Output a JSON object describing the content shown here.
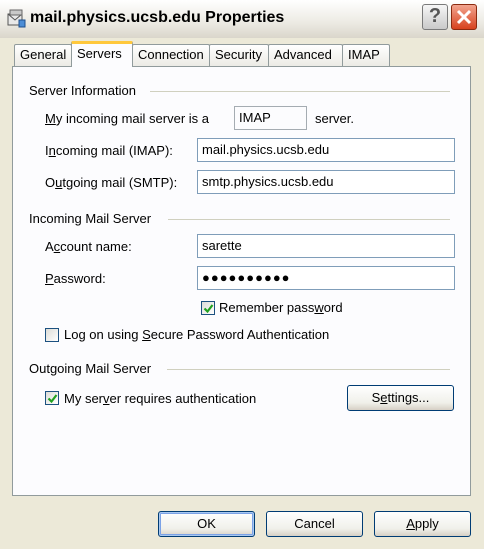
{
  "window": {
    "title": "mail.physics.ucsb.edu Properties"
  },
  "tabs": [
    {
      "label": "General"
    },
    {
      "label": "Servers"
    },
    {
      "label": "Connection"
    },
    {
      "label": "Security"
    },
    {
      "label": "Advanced"
    },
    {
      "label": "IMAP"
    }
  ],
  "active_tab": "Servers",
  "server_info": {
    "heading": "Server Information",
    "incoming_type_prefix_u": "M",
    "incoming_type_prefix_rest": "y incoming mail server is a",
    "incoming_type_value": "IMAP",
    "incoming_type_suffix": "server.",
    "incoming_label_pre": "I",
    "incoming_label_u": "n",
    "incoming_label_post": "coming mail (IMAP):",
    "incoming_value": "mail.physics.ucsb.edu",
    "outgoing_label_pre": "O",
    "outgoing_label_u": "u",
    "outgoing_label_post": "tgoing mail (SMTP):",
    "outgoing_value": "smtp.physics.ucsb.edu"
  },
  "incoming_server": {
    "heading": "Incoming Mail Server",
    "account_label_pre": "A",
    "account_label_u": "c",
    "account_label_post": "count name:",
    "account_value": "sarette",
    "password_label_u": "P",
    "password_label_post": "assword:",
    "password_value": "●●●●●●●●●●",
    "remember_label_pre": "Remember pass",
    "remember_label_u": "w",
    "remember_label_post": "ord",
    "remember_checked": true,
    "spa_label_pre": "Log on using ",
    "spa_label_u": "S",
    "spa_label_post": "ecure Password Authentication",
    "spa_checked": false
  },
  "outgoing_server": {
    "heading": "Outgoing Mail Server",
    "auth_label_pre": "My ser",
    "auth_label_u": "v",
    "auth_label_post": "er requires authentication",
    "auth_checked": true,
    "settings_label_pre": "S",
    "settings_label_u": "e",
    "settings_label_post": "ttings..."
  },
  "buttons": {
    "ok": "OK",
    "cancel": "Cancel",
    "apply_u": "A",
    "apply_rest": "pply"
  },
  "colors": {
    "dialog_bg": "#ECE9D8",
    "tab_highlight": "#FFC83C",
    "check_green": "#21A121"
  }
}
